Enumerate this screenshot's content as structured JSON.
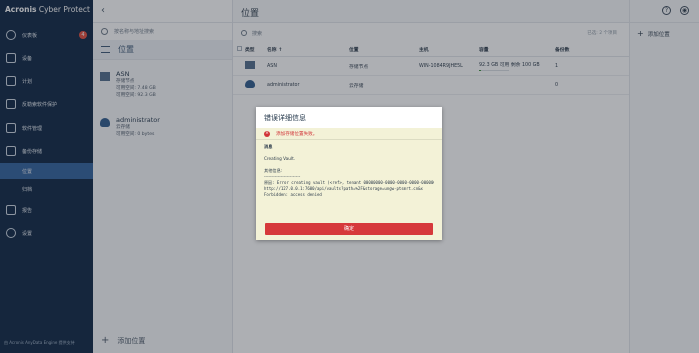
{
  "brand": {
    "bold": "Acronis",
    "rest": " Cyber Protect"
  },
  "nav": {
    "items": [
      {
        "label": "仪表板",
        "badge": "4"
      },
      {
        "label": "设备"
      },
      {
        "label": "计划"
      },
      {
        "label": "反勒索软件保护"
      },
      {
        "label": "软件管理"
      },
      {
        "label": "备份存储"
      },
      {
        "label": "位置"
      },
      {
        "label": "归档"
      },
      {
        "label": "报告"
      },
      {
        "label": "设置"
      }
    ],
    "footer": "由 Acronis AnyData Engine 提供支持"
  },
  "mid": {
    "search_placeholder": "按名称与地址搜索",
    "list_title": "位置",
    "locations": [
      {
        "name": "ASN",
        "lines": [
          "存储节点",
          "可用空间: 7.48 GB",
          "可用空间: 92.3 GB"
        ]
      },
      {
        "name": "administrator",
        "lines": [
          "云存储",
          "可用空间: 0 bytes"
        ]
      }
    ],
    "add_label": "添加位置"
  },
  "main": {
    "title": "位置",
    "search_placeholder": "搜索",
    "pager": "已选: 2 个项目",
    "columns": [
      "类型",
      "名称 ↑",
      "位置",
      "主机",
      "容量",
      "备份数"
    ],
    "rows": [
      {
        "name": "ASN",
        "location": "存储节点",
        "host": "WIN-1084R9JHE5L",
        "capacity": "92.3 GB 可用 剩余 100 GB",
        "backups": "1",
        "fill": 0.08
      },
      {
        "name": "administrator",
        "location": "云存储",
        "host": "",
        "capacity": "",
        "backups": "0",
        "fill": null
      }
    ]
  },
  "right": {
    "add_label": "添加位置",
    "help_glyph": "?",
    "account_glyph": "◉"
  },
  "modal": {
    "title": "错误详细信息",
    "error_line": "添加存储位置失败。",
    "label_message": "消息",
    "message": "Creating Vault.",
    "label_details": "其他信息:",
    "separator": "------------------------",
    "details": [
      "原因: Error creating vault (<ref>, tenant 00000000-0000-0000-0000-000000000001).",
      "http://127.0.0.1:7600/api/vaults?path=%2F&storage=ungw-ptsmrt.cn&x",
      "Forbidden: access denied"
    ],
    "ok_label": "确定"
  }
}
